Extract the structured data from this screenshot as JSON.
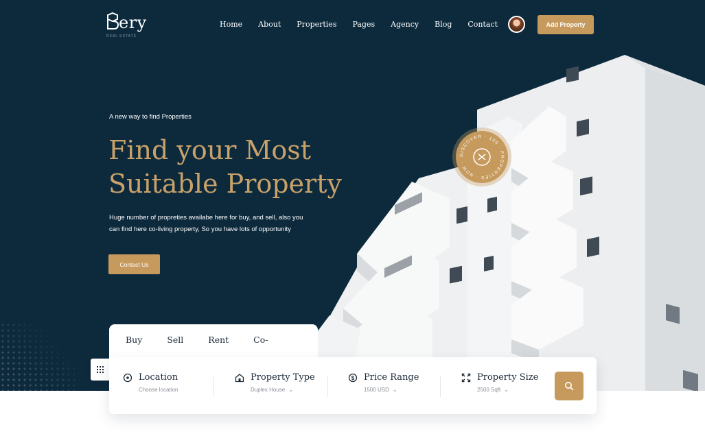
{
  "header": {
    "logo_text": "ery",
    "logo_tagline": "REAL ESTATE",
    "nav": [
      "Home",
      "About",
      "Properties",
      "Pages",
      "Agency",
      "Blog",
      "Contact"
    ],
    "add_property_label": "Add Property"
  },
  "hero": {
    "eyebrow": "A new way to find Properties",
    "headline_line1": "Find your Most",
    "headline_line2": "Suitable Property",
    "description_line1": "Huge number of propreties availabe here for buy, and sell, also you",
    "description_line2": "can find here co-living property, So you have lots of opportunity",
    "contact_label": "Contact Us"
  },
  "badge": {
    "text": "DISCOVER · 100 · PROPERTIES · NOW ·"
  },
  "search": {
    "tabs": [
      "Buy",
      "Sell",
      "Rent",
      "Co-Living"
    ],
    "active_tab": "Buy",
    "fields": {
      "location": {
        "label": "Location",
        "value": "Choose location",
        "icon": "location-pin-icon"
      },
      "property_type": {
        "label": "Property Type",
        "value": "Duplex House",
        "icon": "home-icon"
      },
      "price_range": {
        "label": "Price Range",
        "value": "1500 USD",
        "icon": "dollar-icon"
      },
      "property_size": {
        "label": "Property Size",
        "value": "2500 Sqft",
        "icon": "expand-icon"
      }
    }
  },
  "colors": {
    "navy": "#0d2a3d",
    "gold": "#c69a5c",
    "headline_gold": "#c9a26a",
    "white": "#ffffff"
  }
}
